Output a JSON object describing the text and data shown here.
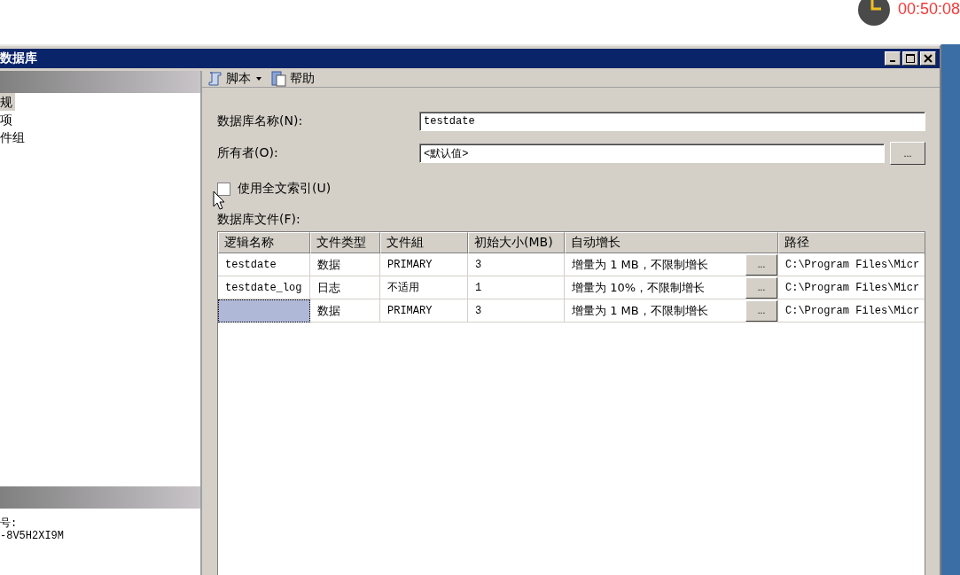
{
  "timer": "00:50:08",
  "window": {
    "title": "数据库"
  },
  "sidebar": {
    "items": [
      {
        "label": "规",
        "selected": true
      },
      {
        "label": "项",
        "selected": false
      },
      {
        "label": "件组",
        "selected": false
      }
    ],
    "connection": {
      "label": "号:",
      "value": "-8V5H2XI9M"
    }
  },
  "toolbar": {
    "items": [
      {
        "kind": "script",
        "label": "脚本"
      },
      {
        "kind": "help",
        "label": "帮助"
      }
    ]
  },
  "form": {
    "name_label": "数据库名称(N):",
    "name_value": "testdate",
    "owner_label": "所有者(O):",
    "owner_value": "<默认值>",
    "owner_button": "...",
    "fulltext": {
      "label": "使用全文索引(U)",
      "checked": false
    },
    "files_label": "数据库文件(F):"
  },
  "table": {
    "columns": [
      "逻辑名称",
      "文件类型",
      "文件組",
      "初始大小(MB)",
      "自动增长",
      "路径"
    ],
    "rows": [
      {
        "selected": false,
        "cells": [
          "testdate",
          "数据",
          "PRIMARY",
          "3",
          "增量为 1 MB，不限制增长",
          "C:\\Program Files\\Micr"
        ],
        "button": "..."
      },
      {
        "selected": false,
        "cells": [
          "testdate_log",
          "日志",
          "不适用",
          "1",
          "增量为 10%，不限制增长",
          "C:\\Program Files\\Micr"
        ],
        "button": "..."
      },
      {
        "selected": true,
        "cells": [
          "",
          "数据",
          "PRIMARY",
          "3",
          "增量为 1 MB，不限制增长",
          "C:\\Program Files\\Micr"
        ],
        "button": "..."
      }
    ]
  }
}
